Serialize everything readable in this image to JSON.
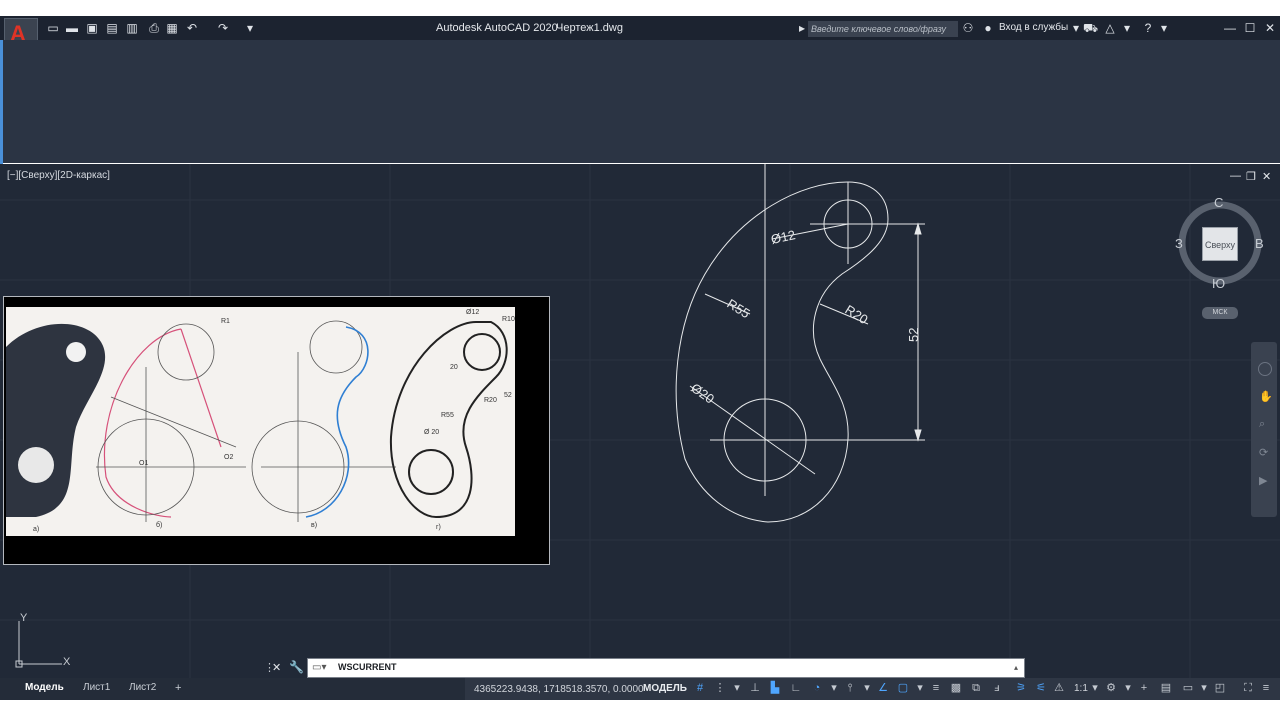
{
  "window": {
    "app_title": "Autodesk AutoCAD 2020",
    "document_title": "Чертеж1.dwg",
    "search_placeholder": "Введите ключевое слово/фразу",
    "signin_label": "Вход в службы"
  },
  "app_button": {
    "letter": "A"
  },
  "quick_access_icons": [
    "new-icon",
    "open-icon",
    "save-icon",
    "save-as-icon",
    "web-mobile-icon",
    "print-icon",
    "undo-icon",
    "redo-icon",
    "customize-icon"
  ],
  "viewport": {
    "label": "[−][Сверху][2D-каркас]",
    "viewcube": {
      "north": "С",
      "south": "Ю",
      "west": "З",
      "east": "В",
      "face": "Сверху",
      "wcs": "МСК"
    },
    "ucs": {
      "x": "X",
      "y": "Y"
    }
  },
  "drawing": {
    "dims": [
      "Ø12",
      "R55",
      "R20",
      "Ø20",
      "52"
    ]
  },
  "reference_image": {
    "labels": [
      "а)",
      "б)",
      "в)",
      "г)",
      "R1",
      "Ø12",
      "R10",
      "R55",
      "R20",
      "Ø 20",
      "20",
      "52",
      "O1",
      "O2"
    ]
  },
  "command_line": {
    "text": "WSCURRENT"
  },
  "layout_tabs": [
    {
      "label": "Модель",
      "active": true
    },
    {
      "label": "Лист1",
      "active": false
    },
    {
      "label": "Лист2",
      "active": false
    }
  ],
  "add_tab_label": "+",
  "status": {
    "coords": "4365223.9438, 1718518.3570, 0.0000",
    "mode": "МОДЕЛЬ",
    "scale": "1:1"
  },
  "colors": {
    "background": "#212937",
    "ribbon": "#2b3444",
    "titlebar": "#1c2330",
    "drawing_line": "#e6e8ea",
    "accent": "#4fa6ff"
  }
}
